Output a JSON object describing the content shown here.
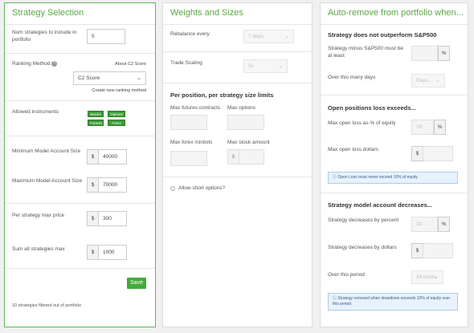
{
  "strategy_selection": {
    "title": "Strategy Selection",
    "num_strategies_label": "Num strategies to include in portfolio",
    "num_strategies_value": "5",
    "ranking_method_label": "Ranking Method",
    "about_link": "About C2 Score",
    "ranking_method_value": "C2 Score",
    "create_ranking_link": "Create new ranking method",
    "allowed_instruments_label": "Allowed instruments",
    "instruments": [
      "Stocks",
      "Options",
      "Futures",
      "Forex"
    ],
    "min_account_label": "Minimum Model Account Size",
    "min_account_value": "40000",
    "max_account_label": "Maximum Model Account Size",
    "max_account_value": "70000",
    "max_price_label": "Per strategy max price",
    "max_price_value": "300",
    "sum_max_label": "Sum all strategies max",
    "sum_max_value": "1000",
    "currency": "$",
    "save_label": "Save",
    "filtered_text": "10 strategies filtered out of portfolio"
  },
  "weights": {
    "title": "Weights and Sizes",
    "rebalance_label": "Rebalance every",
    "rebalance_value": "7 days",
    "scaling_label": "Trade Scaling",
    "scaling_value": "5x",
    "limits_heading": "Per position, per strategy size limits",
    "max_futures_label": "Max futures contracts",
    "max_options_label": "Max options",
    "max_forex_label": "Max forex minilots",
    "max_stock_label": "Max stock amount",
    "currency": "$",
    "allow_short_label": "Allow short options?"
  },
  "autoremove": {
    "title": "Auto-remove from portfolio when...",
    "sp_heading": "Strategy does not outperform S&P500",
    "sp_minus_label": "Strategy minus S&P500 must be at least",
    "percent": "%",
    "over_days_label": "Over this many days",
    "over_days_value": "Days...",
    "open_loss_heading": "Open positions loss exceeds...",
    "max_open_pct_label": "Max open loss as % of equity",
    "max_open_pct_value": "10",
    "max_open_dollars_label": "Max open loss dollars",
    "currency": "$",
    "open_loss_info": "Open Loss must never exceed 10% of equity",
    "decrease_heading": "Strategy model account decreases...",
    "decrease_pct_label": "Strategy decreases by percent",
    "decrease_pct_value": "10",
    "decrease_dollars_label": "Strategy decreases by dollars",
    "period_label": "Over this period",
    "period_value": "24 hours",
    "decrease_info": "Strategy removed when drawdown exceeds 10% of equity over this period"
  }
}
